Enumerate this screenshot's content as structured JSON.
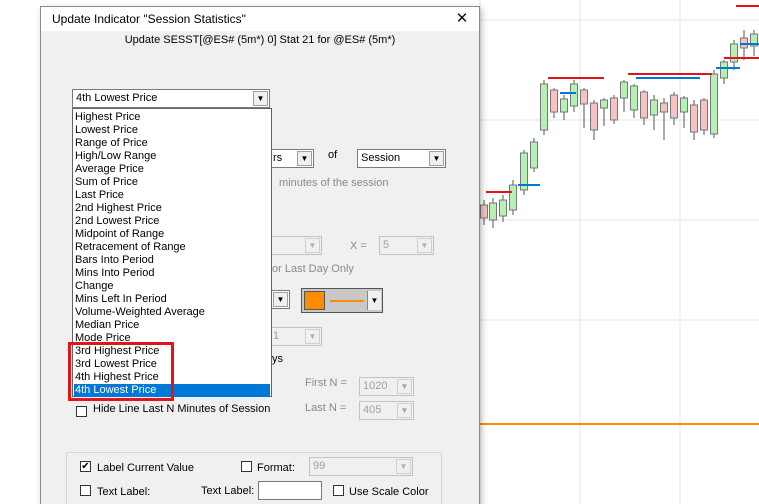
{
  "dialog": {
    "title": "Update Indicator \"Session Statistics\"",
    "close_glyph": "✕",
    "subtitle": "Update SESST[@ES# (5m*) 0] Stat 21 for @ES# (5m*)"
  },
  "stat_combo": {
    "value": "4th Lowest Price",
    "arrow": "▼"
  },
  "droplist": {
    "items": [
      "Highest Price",
      "Lowest Price",
      "Range of Price",
      "High/Low Range",
      "Average Price",
      "Sum of Price",
      "Last Price",
      "2nd Highest Price",
      "2nd Lowest Price",
      "Midpoint of Range",
      "Retracement of Range",
      "Bars Into Period",
      "Mins Into Period",
      "Change",
      "Mins Left In Period",
      "Volume-Weighted Average",
      "Median Price",
      "Mode Price",
      "3rd Highest Price",
      "3rd Lowest Price",
      "4th Highest Price",
      "4th Lowest Price"
    ],
    "selected_index": 21
  },
  "period_row": {
    "partial_combo_text": "rs",
    "of_label": "of",
    "session_combo": "Session"
  },
  "minutes_label": "minutes of the session",
  "x_label": "X =",
  "x_value": "5",
  "last_day_label": "or Last Day Only",
  "partial_value_label": "1",
  "ys_label": "ys",
  "first_n": {
    "label": "First N =",
    "value": "1020"
  },
  "last_n": {
    "label": "Last N =",
    "value": "405"
  },
  "hide_line_label": "Hide Line Last N Minutes of Session",
  "bottom": {
    "label_current_value": "Label Current Value",
    "label_current_checked": "✔",
    "format_label": "Format:",
    "format_value": "99",
    "text_label_chk": "Text Label:",
    "text_label_field_label": "Text Label:",
    "use_scale_color": "Use Scale Color"
  },
  "colors": {
    "accent_orange": "#ff8c00",
    "selection_blue": "#0078d7",
    "highlight_red": "#e1141b"
  }
}
